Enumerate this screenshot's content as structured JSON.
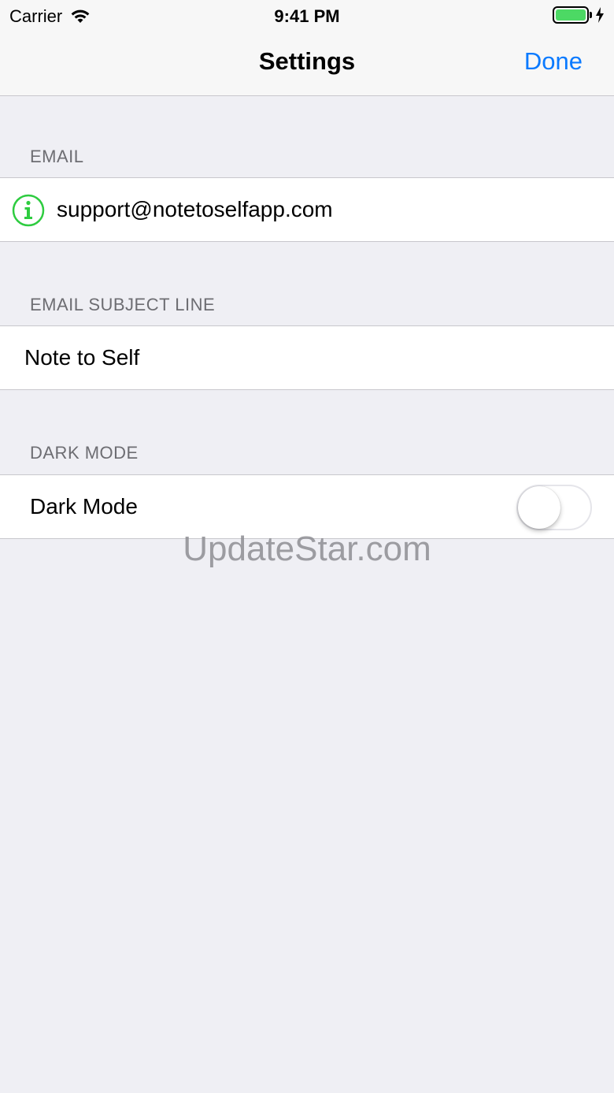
{
  "status_bar": {
    "carrier": "Carrier",
    "time": "9:41 PM",
    "battery_color": "#4cd964"
  },
  "nav": {
    "title": "Settings",
    "done_label": "Done",
    "accent_color": "#0a7aff"
  },
  "sections": {
    "email": {
      "header": "EMAIL",
      "value": "support@notetoselfapp.com",
      "icon": "info-circle-icon",
      "icon_color": "#2ecc40"
    },
    "subject": {
      "header": "EMAIL SUBJECT LINE",
      "value": "Note to Self"
    },
    "dark_mode": {
      "header": "DARK MODE",
      "label": "Dark Mode",
      "enabled": false
    }
  },
  "watermark": "UpdateStar.com"
}
